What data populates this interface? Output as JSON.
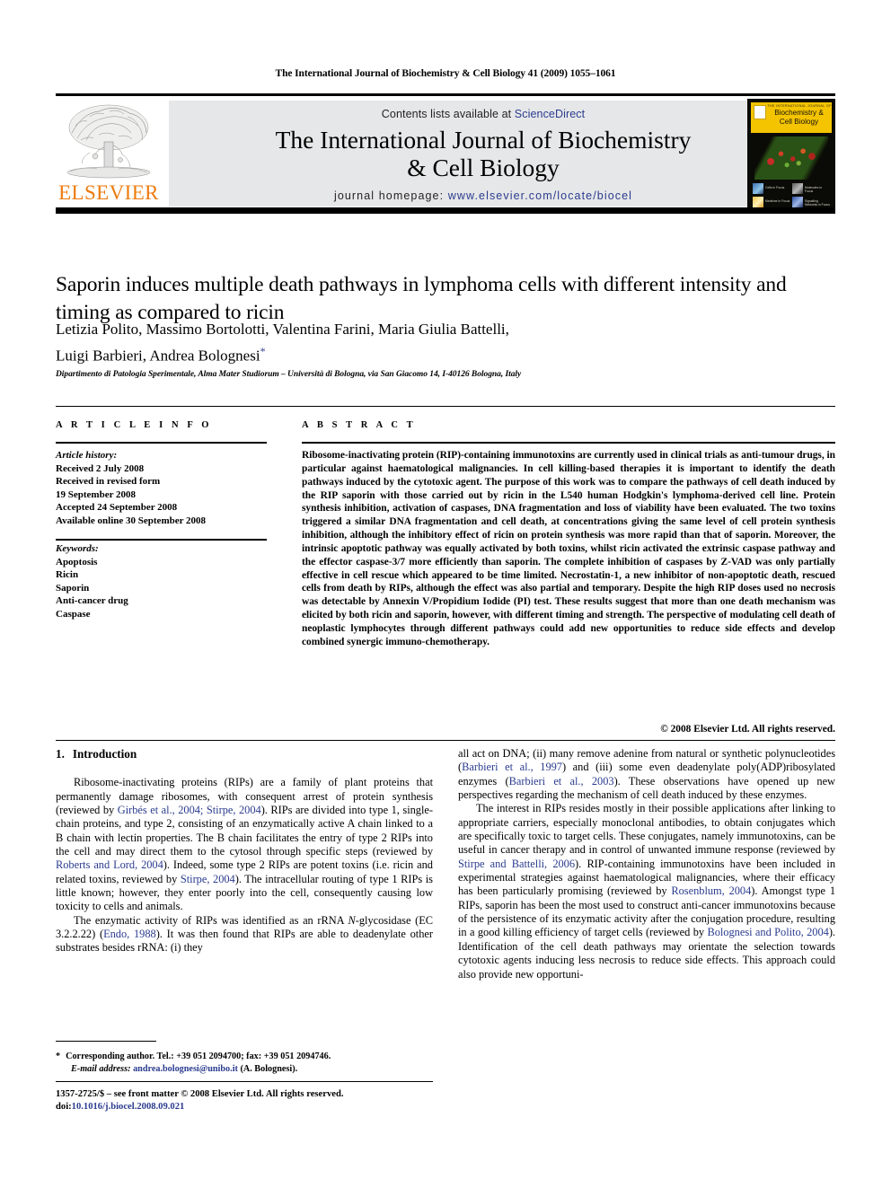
{
  "running_head": "The International Journal of Biochemistry & Cell Biology 41 (2009) 1055–1061",
  "masthead": {
    "publisher_logo_text": "ELSEVIER",
    "contents_prefix": "Contents lists available at ",
    "contents_link": "ScienceDirect",
    "journal_title_line1": "The International Journal of Biochemistry",
    "journal_title_line2": "& Cell Biology",
    "homepage_label": "journal homepage: ",
    "homepage_url": "www.elsevier.com/locate/biocel",
    "cover": {
      "superline": "THE INTERNATIONAL JOURNAL OF",
      "title_line1": "Biochemistry &",
      "title_line2": "Cell Biology",
      "thumb_labels": [
        "Cells in Focus",
        "Molecules in Focus",
        "Medicine in Focus",
        "Signalling Networks in Focus"
      ]
    }
  },
  "article": {
    "title": "Saporin induces multiple death pathways in lymphoma cells with different intensity and timing as compared to ricin",
    "authors_line1": "Letizia Polito, Massimo Bortolotti, Valentina Farini, Maria Giulia Battelli,",
    "authors_line2": "Luigi Barbieri, Andrea Bolognesi",
    "corresponding_marker": "*",
    "affiliation": "Dipartimento di Patologia Sperimentale, Alma Mater Studiorum – Università di Bologna, via San Giacomo 14, I-40126 Bologna, Italy"
  },
  "article_info": {
    "header": "A R T I C L E    I N F O",
    "history_label": "Article history:",
    "history": [
      "Received 2 July 2008",
      "Received in revised form",
      "19 September 2008",
      "Accepted 24 September 2008",
      "Available online 30 September 2008"
    ],
    "keywords_label": "Keywords:",
    "keywords": [
      "Apoptosis",
      "Ricin",
      "Saporin",
      "Anti-cancer drug",
      "Caspase"
    ]
  },
  "abstract": {
    "header": "A B S T R A C T",
    "text": "Ribosome-inactivating protein (RIP)-containing immunotoxins are currently used in clinical trials as anti-tumour drugs, in particular against haematological malignancies. In cell killing-based therapies it is important to identify the death pathways induced by the cytotoxic agent. The purpose of this work was to compare the pathways of cell death induced by the RIP saporin with those carried out by ricin in the L540 human Hodgkin's lymphoma-derived cell line. Protein synthesis inhibition, activation of caspases, DNA fragmentation and loss of viability have been evaluated. The two toxins triggered a similar DNA fragmentation and cell death, at concentrations giving the same level of cell protein synthesis inhibition, although the inhibitory effect of ricin on protein synthesis was more rapid than that of saporin. Moreover, the intrinsic apoptotic pathway was equally activated by both toxins, whilst ricin activated the extrinsic caspase pathway and the effector caspase-3/7 more efficiently than saporin. The complete inhibition of caspases by Z-VAD was only partially effective in cell rescue which appeared to be time limited. Necrostatin-1, a new inhibitor of non-apoptotic death, rescued cells from death by RIPs, although the effect was also partial and temporary. Despite the high RIP doses used no necrosis was detectable by Annexin V/Propidium Iodide (PI) test. These results suggest that more than one death mechanism was elicited by both ricin and saporin, however, with different timing and strength. The perspective of modulating cell death of neoplastic lymphocytes through different pathways could add new opportunities to reduce side effects and develop combined synergic immuno-chemotherapy.",
    "copyright": "© 2008 Elsevier Ltd. All rights reserved."
  },
  "introduction": {
    "number": "1.",
    "heading": "Introduction",
    "left_p1_a": "Ribosome-inactivating proteins (RIPs) are a family of plant proteins that permanently damage ribosomes, with consequent arrest of protein synthesis (reviewed by ",
    "left_p1_ref1": "Girbés et al., 2004; Stirpe, 2004",
    "left_p1_b": "). RIPs are divided into type 1, single-chain proteins, and type 2, consisting of an enzymatically active A chain linked to a B chain with lectin properties. The B chain facilitates the entry of type 2 RIPs into the cell and may direct them to the cytosol through specific steps (reviewed by ",
    "left_p1_ref2": "Roberts and Lord, 2004",
    "left_p1_c": "). Indeed, some type 2 RIPs are potent toxins (i.e. ricin and related toxins, reviewed by ",
    "left_p1_ref3": "Stirpe, 2004",
    "left_p1_d": "). The intracellular routing of type 1 RIPs is little known; however, they enter poorly into the cell, consequently causing low toxicity to cells and animals.",
    "left_p2_a": "The enzymatic activity of RIPs was identified as an rRNA ",
    "left_p2_italic": "N-",
    "left_p2_b": "glycosidase (EC 3.2.2.22) (",
    "left_p2_ref1": "Endo, 1988",
    "left_p2_c": "). It was then found that RIPs are able to deadenylate other substrates besides rRNA: (i) they",
    "right_p1_a": "all act on DNA; (ii) many remove adenine from natural or synthetic polynucleotides (",
    "right_p1_ref1": "Barbieri et al., 1997",
    "right_p1_b": ") and (iii) some even deadenylate poly(ADP)ribosylated enzymes (",
    "right_p1_ref2": "Barbieri et al., 2003",
    "right_p1_c": "). These observations have opened up new perspectives regarding the mechanism of cell death induced by these enzymes.",
    "right_p2_a": "The interest in RIPs resides mostly in their possible applications after linking to appropriate carriers, especially monoclonal antibodies, to obtain conjugates which are specifically toxic to target cells. These conjugates, namely immunotoxins, can be useful in cancer therapy and in control of unwanted immune response (reviewed by ",
    "right_p2_ref1": "Stirpe and Battelli, 2006",
    "right_p2_b": "). RIP-containing immunotoxins have been included in experimental strategies against haematological malignancies, where their efficacy has been particularly promising (reviewed by ",
    "right_p2_ref2": "Rosenblum, 2004",
    "right_p2_c": "). Amongst type 1 RIPs, saporin has been the most used to construct anti-cancer immunotoxins because of the persistence of its enzymatic activity after the conjugation procedure, resulting in a good killing efficiency of target cells (reviewed by ",
    "right_p2_ref3": "Bolognesi and Polito, 2004",
    "right_p2_d": "). Identification of the cell death pathways may orientate the selection towards cytotoxic agents inducing less necrosis to reduce side effects. This approach could also provide new opportuni-"
  },
  "footnote": {
    "marker": "*",
    "line1": "Corresponding author. Tel.: +39 051 2094700; fax: +39 051 2094746.",
    "email_label": "E-mail address:",
    "email": "andrea.bolognesi@unibo.it",
    "email_suffix": " (A. Bolognesi)."
  },
  "imprint": {
    "line1": "1357-2725/$ – see front matter © 2008 Elsevier Ltd. All rights reserved.",
    "doi_label": "doi:",
    "doi_value": "10.1016/j.biocel.2008.09.021"
  },
  "colors": {
    "link": "#2b3c8f",
    "elsevier_orange": "#ec7c10",
    "banner_bg": "#e6e7e8",
    "cover_yellow": "#f4c400"
  }
}
